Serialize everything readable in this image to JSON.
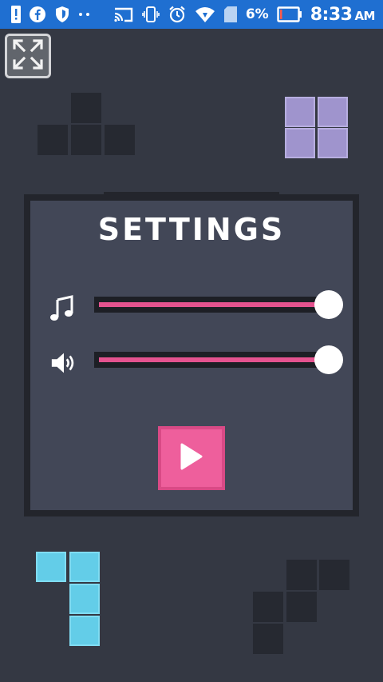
{
  "status_bar": {
    "battery_percent": "6%",
    "time": "8:33",
    "ampm": "AM",
    "background_color": "#1f6fd1",
    "icons": [
      "alert-icon",
      "facebook-icon",
      "shield-icon",
      "more-dots-icon",
      "cast-icon",
      "vibrate-icon",
      "alarm-icon",
      "wifi-icon",
      "sim-icon",
      "battery-icon"
    ]
  },
  "settings": {
    "title": "SETTINGS",
    "music": {
      "icon": "music-note-icon",
      "level": 1.0
    },
    "sound": {
      "icon": "speaker-icon",
      "level": 1.0
    },
    "play_icon": "play-icon",
    "accent_color": "#e4538f"
  },
  "decor": {
    "fullscreen_icon": "fullscreen-icon",
    "colors": {
      "purple": "#9f94cd",
      "cyan": "#63cde8",
      "dark": "#262931",
      "panel": "#424757"
    }
  }
}
